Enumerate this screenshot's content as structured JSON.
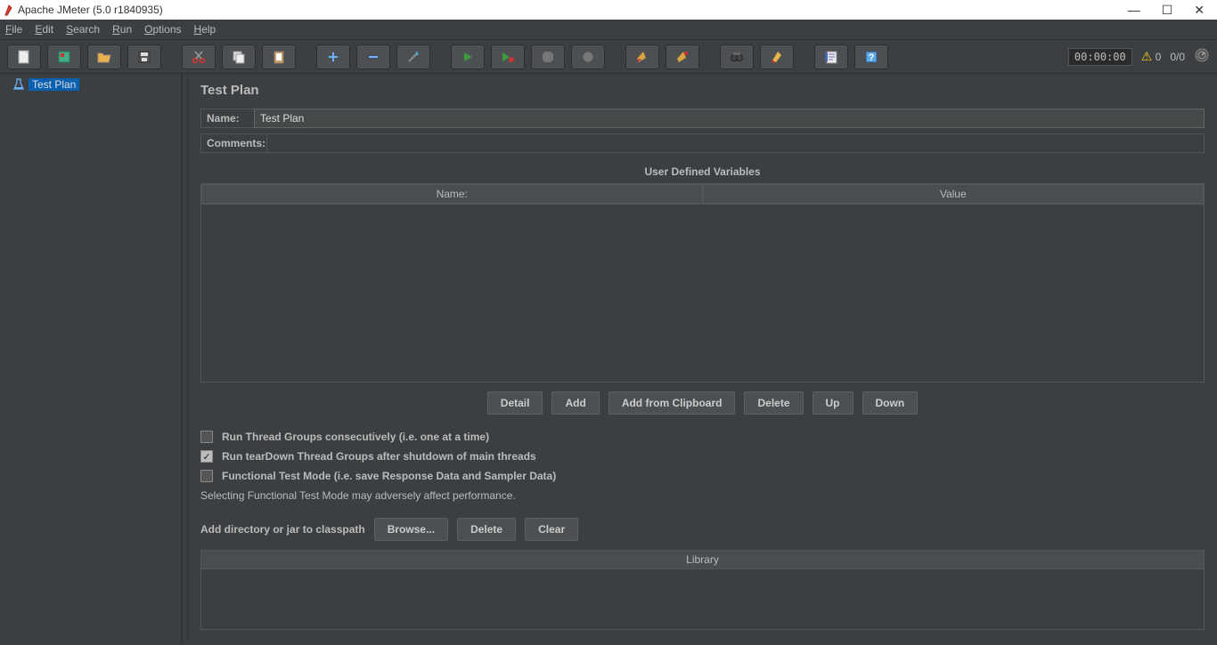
{
  "window": {
    "title": "Apache JMeter (5.0 r1840935)"
  },
  "menubar": {
    "file": "File",
    "edit": "Edit",
    "search": "Search",
    "run": "Run",
    "options": "Options",
    "help": "Help"
  },
  "toolbar": {
    "timer": "00:00:00",
    "warn_count": "0",
    "threads": "0/0"
  },
  "tree": {
    "root_label": "Test Plan"
  },
  "panel": {
    "title": "Test Plan",
    "name_label": "Name:",
    "name_value": "Test Plan",
    "comments_label": "Comments:",
    "comments_value": "",
    "vars_title": "User Defined Variables",
    "col_name": "Name:",
    "col_value": "Value",
    "btn_detail": "Detail",
    "btn_add": "Add",
    "btn_add_clip": "Add from Clipboard",
    "btn_delete": "Delete",
    "btn_up": "Up",
    "btn_down": "Down",
    "chk_consec": "Run Thread Groups consecutively (i.e. one at a time)",
    "chk_teardown": "Run tearDown Thread Groups after shutdown of main threads",
    "chk_functional": "Functional Test Mode (i.e. save Response Data and Sampler Data)",
    "functional_hint": "Selecting Functional Test Mode may adversely affect performance.",
    "classpath_label": "Add directory or jar to classpath",
    "btn_browse": "Browse...",
    "btn_cp_delete": "Delete",
    "btn_clear": "Clear",
    "lib_header": "Library"
  }
}
